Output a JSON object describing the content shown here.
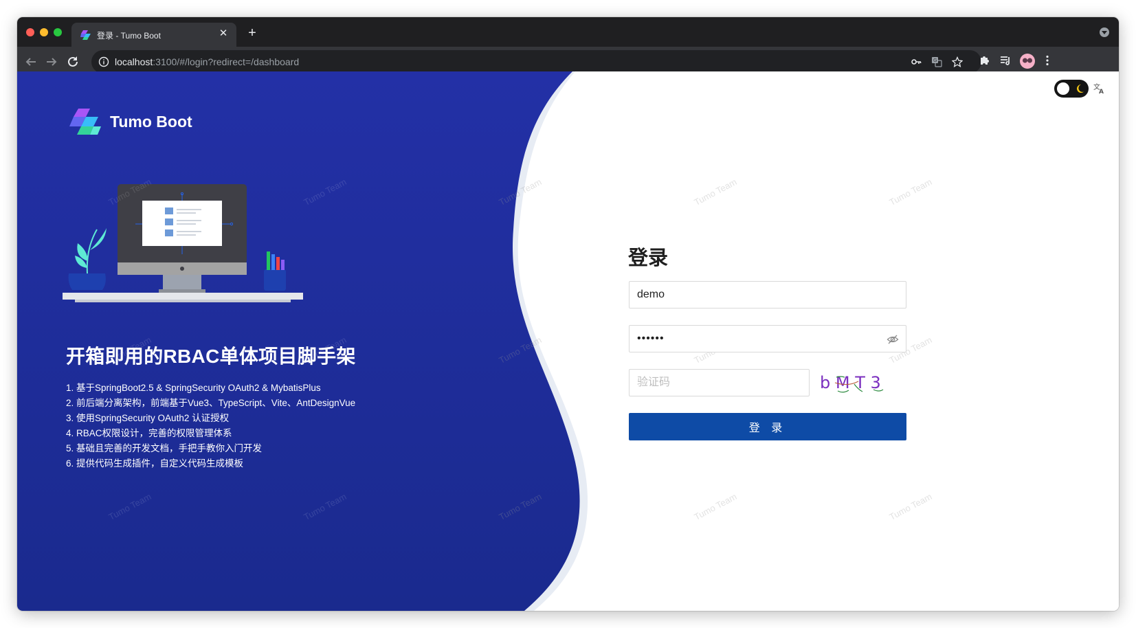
{
  "browser": {
    "tab_title": "登录 - Tumo Boot",
    "url_host": "localhost",
    "url_rest": ":3100/#/login?redirect=/dashboard"
  },
  "brand": {
    "name": "Tumo Boot"
  },
  "hero": {
    "title": "开箱即用的RBAC单体项目脚手架",
    "features": [
      "1. 基于SpringBoot2.5 & SpringSecurity OAuth2 & MybatisPlus",
      "2. 前后端分离架构，前端基于Vue3、TypeScript、Vite、AntDesignVue",
      "3. 使用SpringSecurity OAuth2 认证授权",
      "4. RBAC权限设计，完善的权限管理体系",
      "5. 基础且完善的开发文档，手把手教你入门开发",
      "6. 提供代码生成插件，自定义代码生成模板"
    ]
  },
  "watermark": {
    "text": "Tumo Team"
  },
  "login": {
    "title": "登录",
    "username_value": "demo",
    "password_masked": "••••••",
    "captcha_placeholder": "验证码",
    "captcha_text": "b M T 3",
    "submit_label": "登 录"
  },
  "colors": {
    "left_panel_top": "#2330a6",
    "left_panel_bottom": "#1a2a8e",
    "primary_button": "#0e4ba6"
  },
  "icons": {
    "back": "arrow-left-icon",
    "forward": "arrow-right-icon",
    "reload": "reload-icon",
    "site_info": "info-icon",
    "key": "key-icon",
    "translate": "translate-icon",
    "bookmark": "star-icon",
    "extensions": "puzzle-icon",
    "reading_list": "reading-list-icon",
    "menu": "kebab-menu-icon",
    "password_visibility": "eye-invisible-icon",
    "dark_mode": "moon-icon",
    "language": "language-icon"
  }
}
